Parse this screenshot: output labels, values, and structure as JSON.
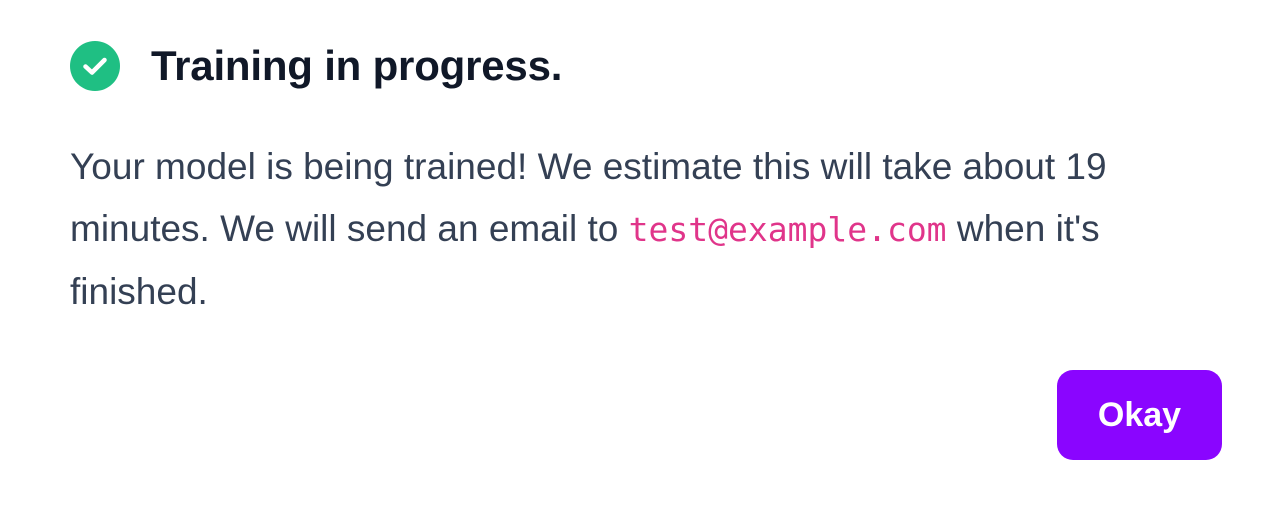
{
  "dialog": {
    "status_icon": "check-circle-icon",
    "title": "Training in progress.",
    "message": {
      "before_email": "Your model is being trained! We estimate this will take about 19 minutes. We will send an email to ",
      "email": "test@example.com",
      "after_email": " when it's finished."
    },
    "okay_label": "Okay"
  },
  "colors": {
    "success": "#1fbf83",
    "title_text": "#101828",
    "body_text": "#344054",
    "email_text": "#e0358a",
    "button_bg": "#8a05ff",
    "button_text": "#ffffff"
  }
}
